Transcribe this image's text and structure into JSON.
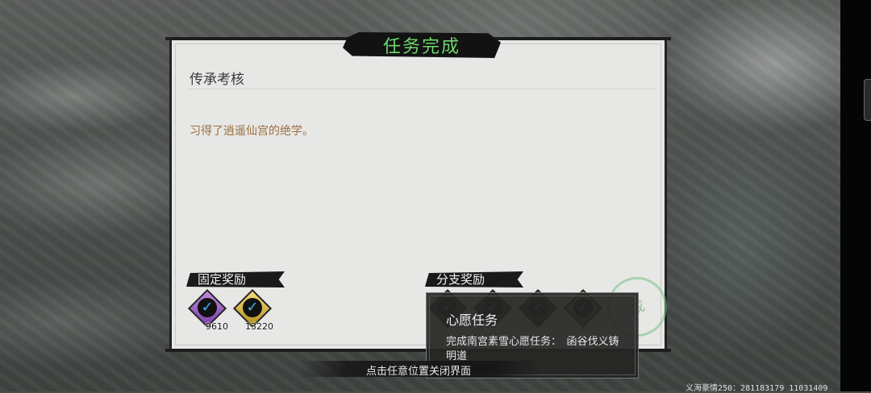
{
  "dialog": {
    "title": "任务完成",
    "quest_name": "传承考核",
    "quest_desc": "习得了逍遥仙宫的绝学。"
  },
  "rewards": {
    "fixed_label": "固定奖励",
    "branch_label": "分支奖励",
    "fixed_items": [
      {
        "icon": "purple-gem-icon",
        "count": "9610"
      },
      {
        "icon": "gold-coin-icon",
        "count": "13220"
      }
    ],
    "branch_items": [
      {
        "icon": "branch-reward-icon"
      },
      {
        "icon": "branch-reward-icon"
      },
      {
        "icon": "branch-reward-icon"
      },
      {
        "icon": "heart-reward-icon"
      },
      {
        "icon": "empty-slot-icon"
      }
    ],
    "stamp_text": "成"
  },
  "tooltip": {
    "title": "心愿任务",
    "desc": "完成南宫素雪心愿任务：　函谷伐义铸明道"
  },
  "hint": "点击任意位置关闭界面",
  "watermark": "义海豪情250：281183179  11031409",
  "colors": {
    "title_green": "#6fd66f",
    "desc_brown": "#9b6f3f",
    "check_blue": "#41b3e6"
  }
}
